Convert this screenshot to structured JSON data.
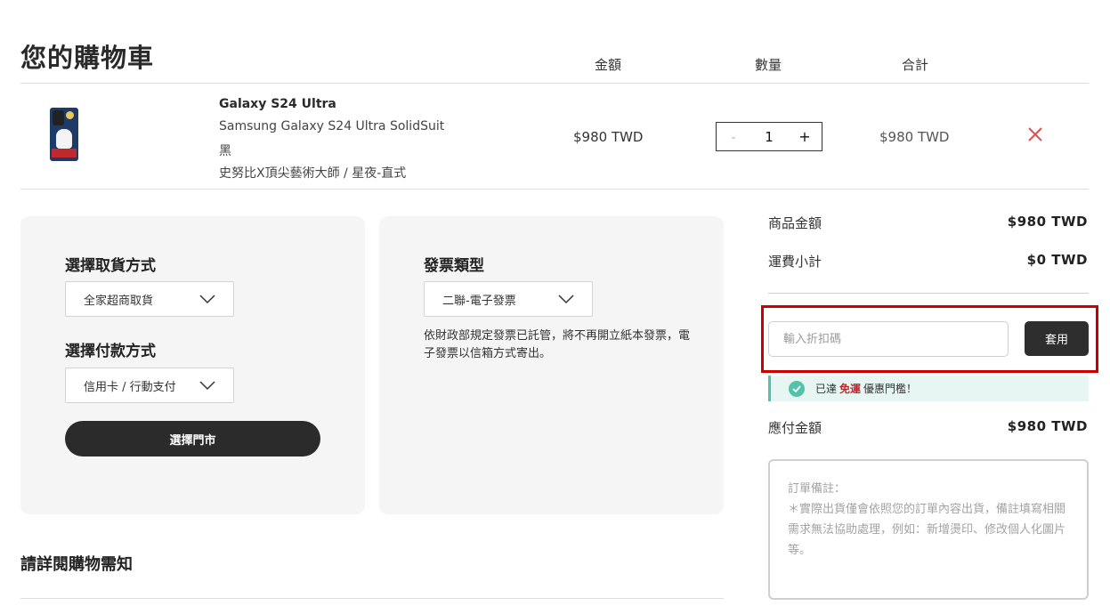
{
  "cart": {
    "title": "您的購物車",
    "columns": {
      "amount": "金額",
      "quantity": "數量",
      "total": "合計"
    }
  },
  "item": {
    "name": "Galaxy S24 Ultra",
    "model": "Samsung Galaxy S24 Ultra SolidSuit",
    "color": "黑",
    "design": "史努比X頂尖藝術大師 / 星夜-直式",
    "price": "$980 TWD",
    "quantity": "1",
    "minus": "-",
    "plus": "+",
    "subtotal": "$980 TWD"
  },
  "delivery": {
    "pickup_title": "選擇取貨方式",
    "pickup_selected": "全家超商取貨",
    "payment_title": "選擇付款方式",
    "payment_selected": "信用卡 / 行動支付",
    "store_button": "選擇門市"
  },
  "invoice": {
    "title": "發票類型",
    "selected": "二聯-電子發票",
    "note": "依財政部規定發票已託管，將不再開立紙本發票，電子發票以信箱方式寄出。"
  },
  "notice": {
    "title": "請詳閱購物需知"
  },
  "summary": {
    "goods_label": "商品金額",
    "goods_value": "$980 TWD",
    "shipping_label": "運費小計",
    "shipping_value": "$0 TWD",
    "coupon_placeholder": "輸入折扣碼",
    "apply_label": "套用",
    "banner_prefix": "已達",
    "banner_free": "免運",
    "banner_suffix": "優惠門檻！",
    "payable_label": "應付金額",
    "payable_value": "$980 TWD",
    "remarks_title": "訂單備註：",
    "remarks_hint": "＊實際出貨僅會依照您的訂單內容出貨，備註填寫相關需求無法協助處理，例如：新增燙印、修改個人化圖片等。"
  },
  "colors": {
    "dark_button": "#2e2e2e",
    "panel_bg": "#f5f5f5",
    "highlight_border": "#cc0000",
    "success_accent": "#52c2ad",
    "remove_icon": "#d9534f"
  },
  "icons": [
    "phone-case-thumbnail",
    "close-icon",
    "chevron-down-icon",
    "check-circle-icon"
  ]
}
